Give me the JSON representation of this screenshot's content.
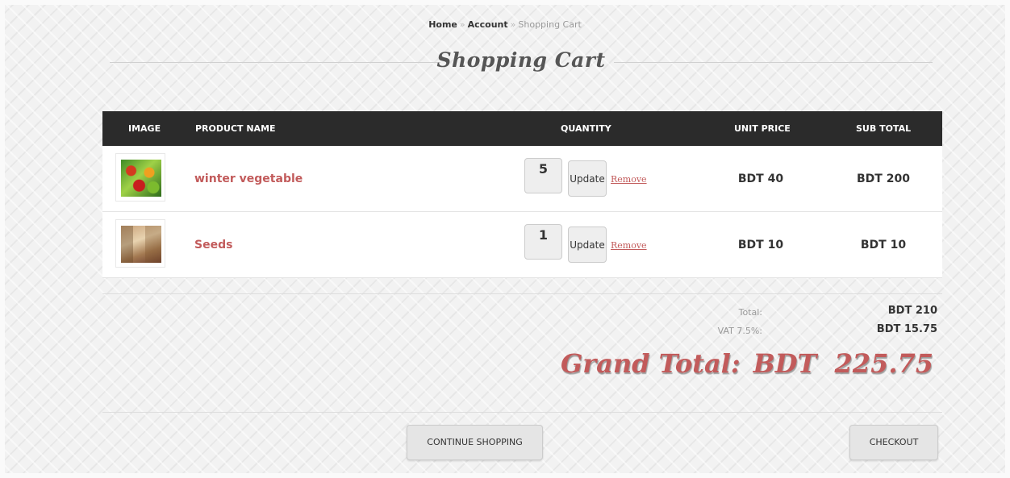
{
  "breadcrumb": {
    "home": "Home",
    "account": "Account",
    "current": "Shopping Cart",
    "separator": "»"
  },
  "page_title": "Shopping Cart",
  "table": {
    "headers": {
      "image": "IMAGE",
      "product": "PRODUCT NAME",
      "quantity": "QUANTITY",
      "unit_price": "UNIT PRICE",
      "sub_total": "SUB TOTAL"
    },
    "rows": [
      {
        "name": "winter vegetable",
        "quantity": "5",
        "update": "Update",
        "remove": "Remove",
        "unit_price": "BDT 40",
        "sub_total": "BDT 200",
        "image": "vegetables-thumbnail"
      },
      {
        "name": "Seeds",
        "quantity": "1",
        "update": "Update",
        "remove": "Remove",
        "unit_price": "BDT 10",
        "sub_total": "BDT 10",
        "image": "seeds-thumbnail"
      }
    ]
  },
  "totals": {
    "total_label": "Total:",
    "total_value": "BDT 210",
    "vat_label": "VAT 7.5%:",
    "vat_value": "BDT 15.75"
  },
  "grand_total": {
    "label": "Grand Total:",
    "value": "BDT  225.75"
  },
  "buttons": {
    "continue": "CONTINUE SHOPPING",
    "checkout": "CHECKOUT"
  },
  "colors": {
    "accent": "#c25b5b",
    "header_bg": "#2b2b2b"
  }
}
